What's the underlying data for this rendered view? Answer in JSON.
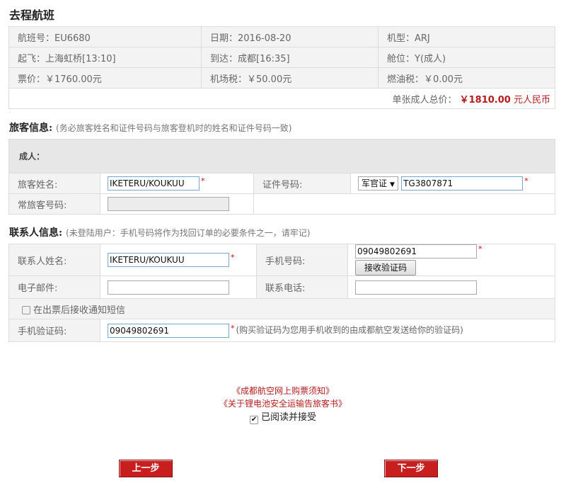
{
  "flight": {
    "title": "去程航班",
    "flight_no": "航班号：EU6680",
    "date": "日期：2016-08-20",
    "aircraft": "机型：ARJ",
    "depart": "起飞：上海虹桥[13:10]",
    "arrive": "到达：成都[16:35]",
    "cabin": "舱位：Y(成人)",
    "fare": "票价：￥1760.00元",
    "airport_tax": "机场税：￥50.00元",
    "fuel_tax": "燃油税：￥0.00元",
    "total_label": "单张成人总价：",
    "total_amount": "￥1810.00",
    "total_unit": "元人民币"
  },
  "passenger": {
    "title": "旅客信息:",
    "note": "(务必旅客姓名和证件号码与旅客登机时的姓名和证件号码一致)",
    "group": "成人：",
    "name_label": "旅客姓名:",
    "name_value": "IKETERU/KOUKUU",
    "id_label": "证件号码:",
    "id_type": "军官证",
    "id_value": "TG3807871",
    "ff_label": "常旅客号码:",
    "ff_value": "",
    "required": "*"
  },
  "contact": {
    "title": "联系人信息:",
    "note": "(未登陆用户：手机号码将作为找回订单的必要条件之一，请牢记)",
    "name_label": "联系人姓名:",
    "name_value": "IKETERU/KOUKUU",
    "mobile_label": "手机号码:",
    "mobile_value": "09049802691",
    "get_code_button": "接收验证码",
    "email_label": "电子邮件:",
    "email_value": "",
    "phone_label": "联系电话:",
    "phone_value": "",
    "sms_checkbox_label": "在出票后接收通知短信",
    "code_label": "手机验证码:",
    "code_value": "09049802691",
    "code_explain": "(购买验证码为您用手机收到的由成都航空发送给你的验证码)",
    "required": "*"
  },
  "terms": {
    "notice_link": "《成都航空网上购票须知》",
    "battery_link": "《关于锂电池安全运输告旅客书》",
    "accept_label": "已阅读并接受",
    "accepted": true
  },
  "nav": {
    "prev": "上一步",
    "next": "下一步"
  },
  "colors": {
    "accent": "#c81e1e",
    "price": "#b71c1c",
    "row_bg": "#f3f3f3"
  }
}
